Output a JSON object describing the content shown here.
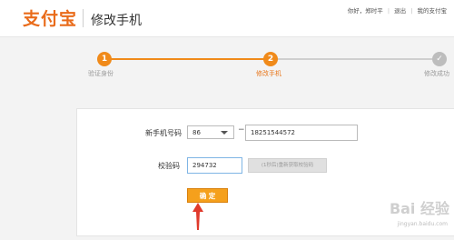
{
  "header": {
    "logo_text": "支付宝",
    "page_title": "修改手机",
    "greeting": "你好，",
    "user_name": "郑时平",
    "logout": "退出",
    "my_alipay": "我的支付宝"
  },
  "steps": [
    {
      "number": "1",
      "label": "验证身份",
      "status": "done"
    },
    {
      "number": "2",
      "label": "修改手机",
      "status": "current"
    },
    {
      "number": "✓",
      "label": "修改成功",
      "status": "todo"
    }
  ],
  "form": {
    "phone_label": "新手机号码",
    "country_code": "86",
    "dash": "−",
    "phone_value": "18251544572",
    "code_label": "校验码",
    "code_value": "294732",
    "get_code_button": "(1秒后)重新获取校验码",
    "confirm_button": "确 定"
  },
  "watermark": {
    "brand": "Bai 经验",
    "url": "jingyan.baidu.com"
  },
  "colors": {
    "accent": "#f08a1a",
    "button": "#f5a01c",
    "arrow": "#e03a2c"
  }
}
